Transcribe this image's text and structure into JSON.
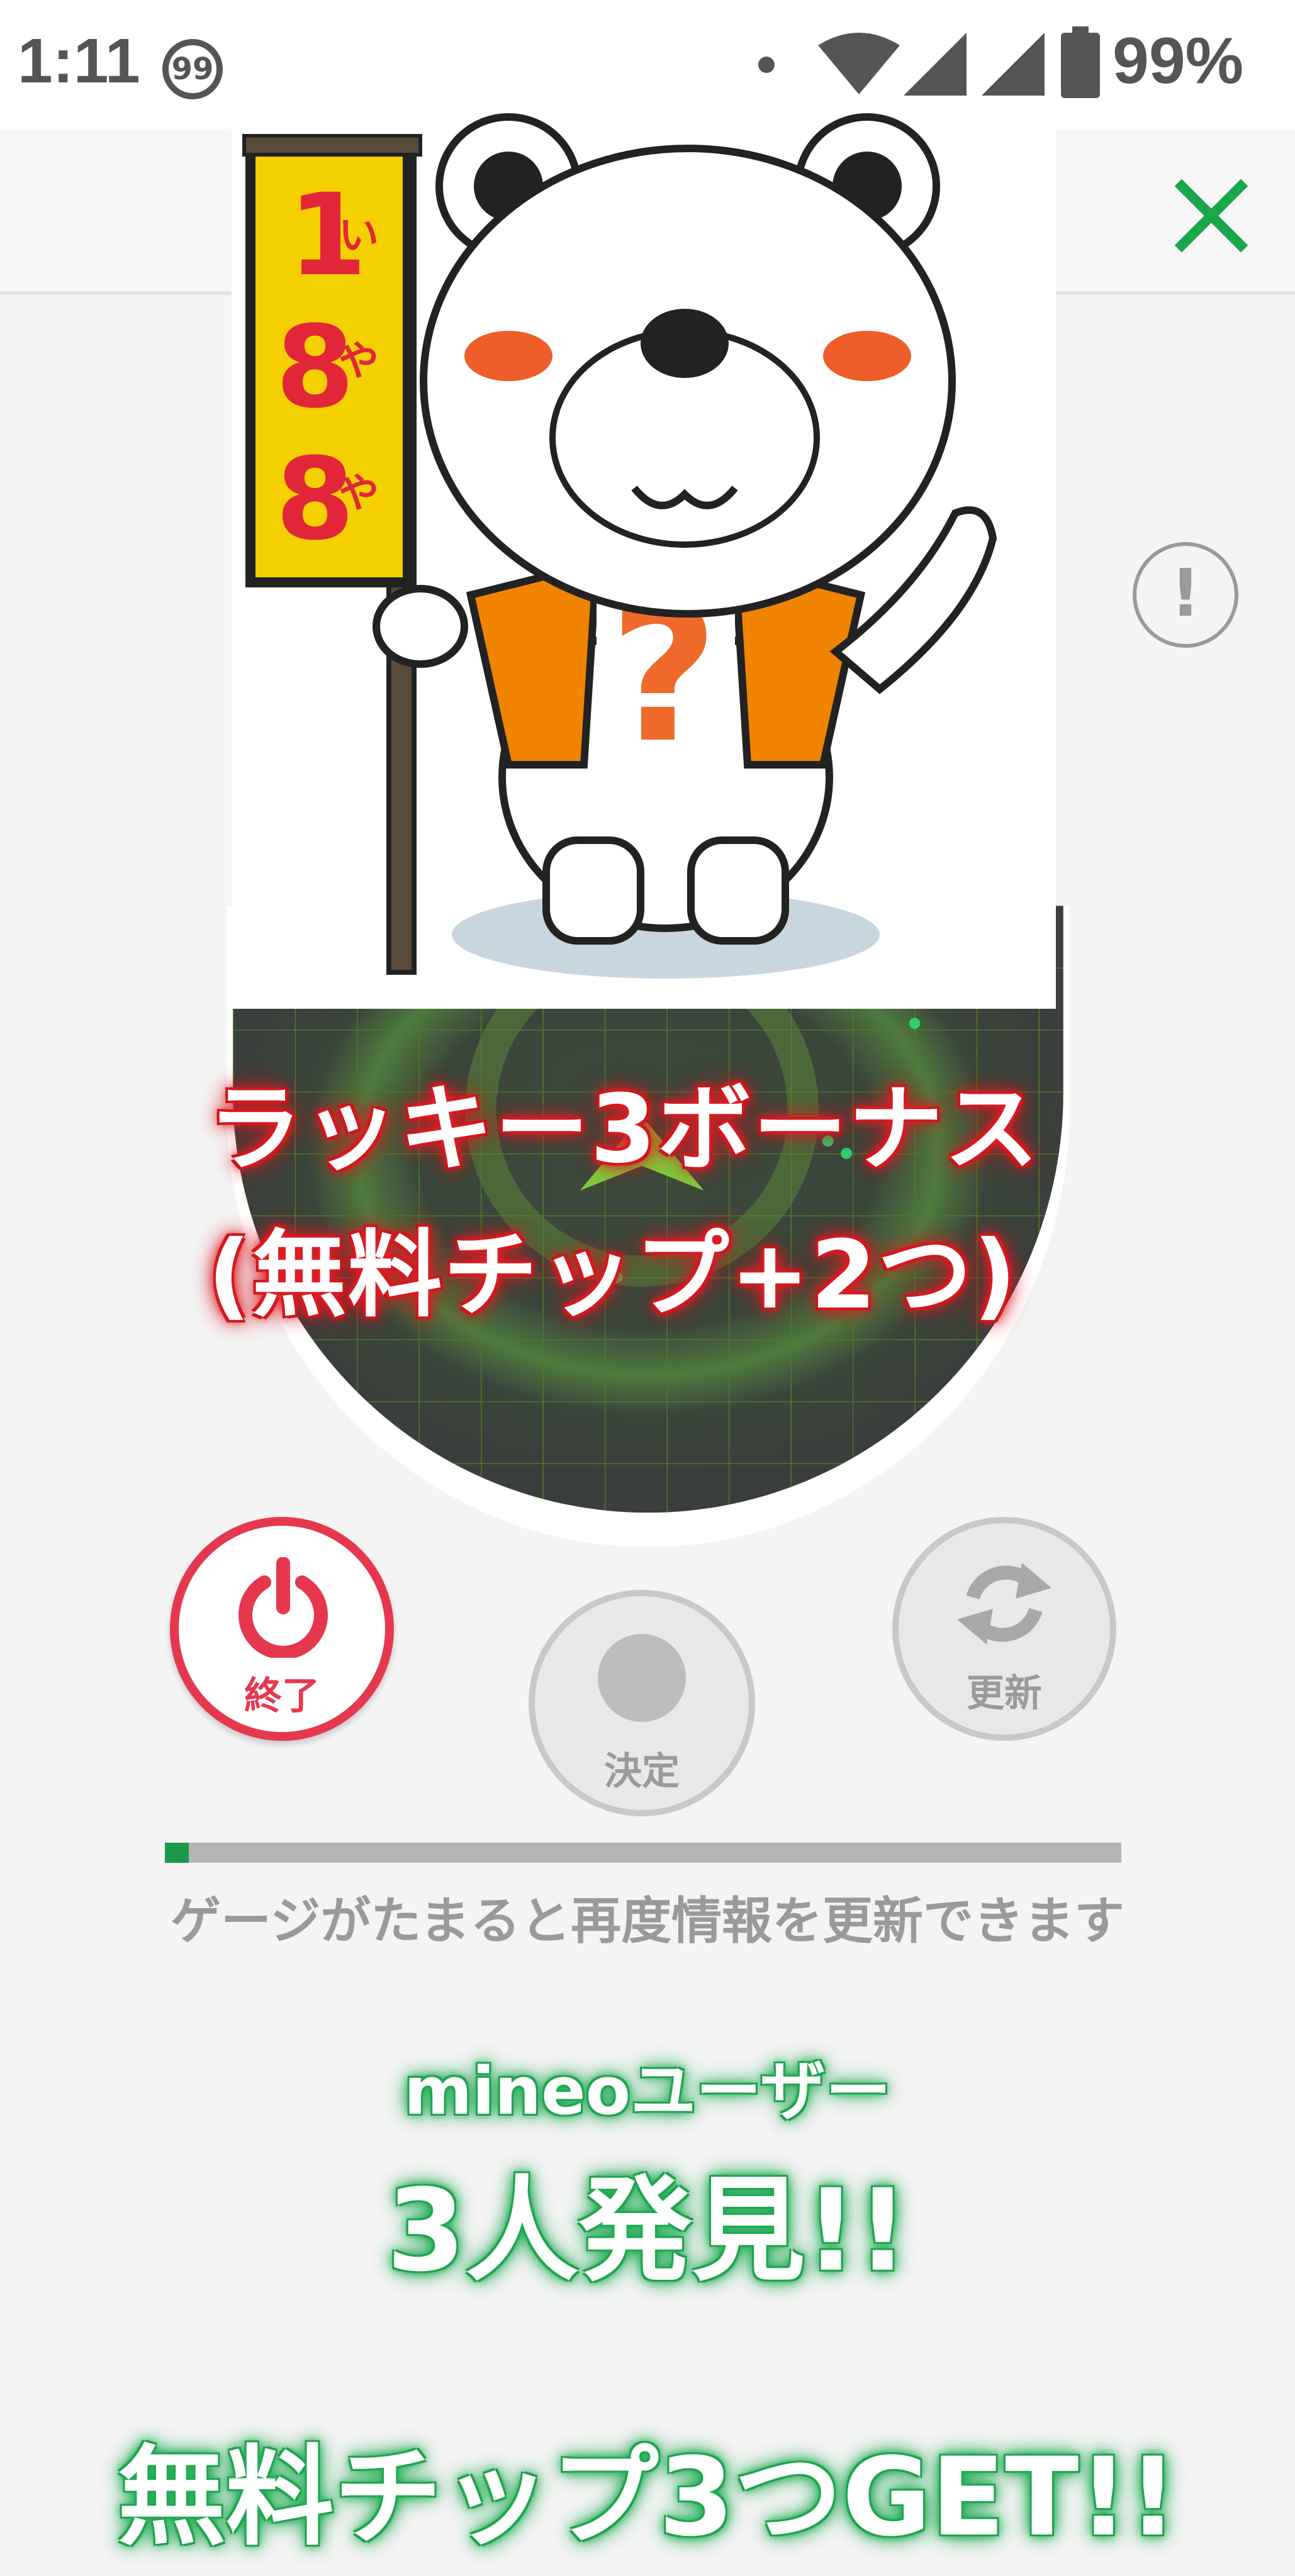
{
  "status_bar": {
    "time": "1:11",
    "notification_badge": "99",
    "battery_percent": "99%",
    "icons": [
      "dot-icon",
      "wifi-icon",
      "cell-signal-icon",
      "cell-signal-2-icon",
      "battery-icon"
    ]
  },
  "toolbar": {
    "close_icon": "close-icon",
    "accent_color": "#1aa64a"
  },
  "info_button": {
    "label": "!"
  },
  "bear_flag": {
    "chars": [
      "1",
      "い",
      "8",
      "や",
      "8",
      "や"
    ]
  },
  "bonus": {
    "line1": "ラッキー3ボーナス",
    "line2": "(無料チップ+2つ)"
  },
  "controls": {
    "end_label": "終了",
    "decide_label": "決定",
    "refresh_label": "更新"
  },
  "gauge": {
    "progress": 0.025,
    "hint": "ゲージがたまると再度情報を更新できます"
  },
  "result": {
    "users_label": "mineoユーザー",
    "found_label": "3人発見!!",
    "chips_label": "無料チップ3つGET!!"
  }
}
